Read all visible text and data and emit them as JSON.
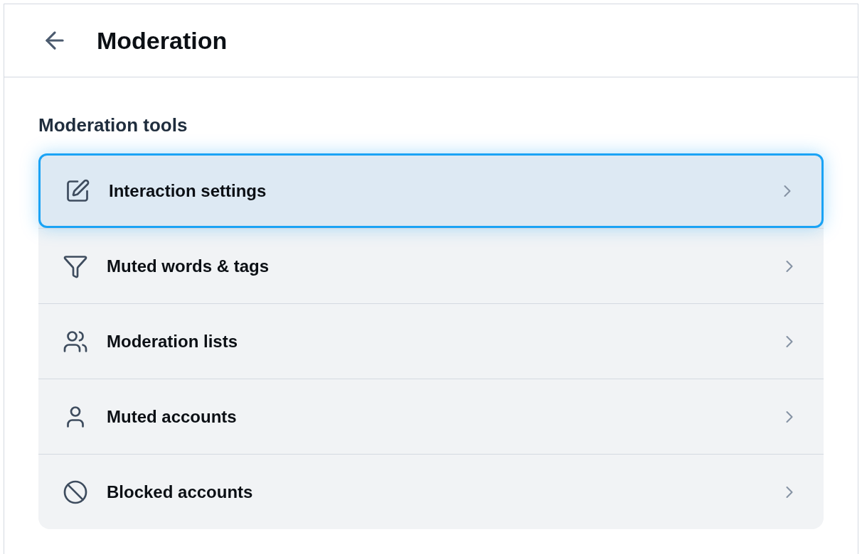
{
  "header": {
    "title": "Moderation"
  },
  "section": {
    "title": "Moderation tools"
  },
  "items": [
    {
      "label": "Interaction settings",
      "selected": true
    },
    {
      "label": "Muted words & tags",
      "selected": false
    },
    {
      "label": "Moderation lists",
      "selected": false
    },
    {
      "label": "Muted accounts",
      "selected": false
    },
    {
      "label": "Blocked accounts",
      "selected": false
    }
  ]
}
